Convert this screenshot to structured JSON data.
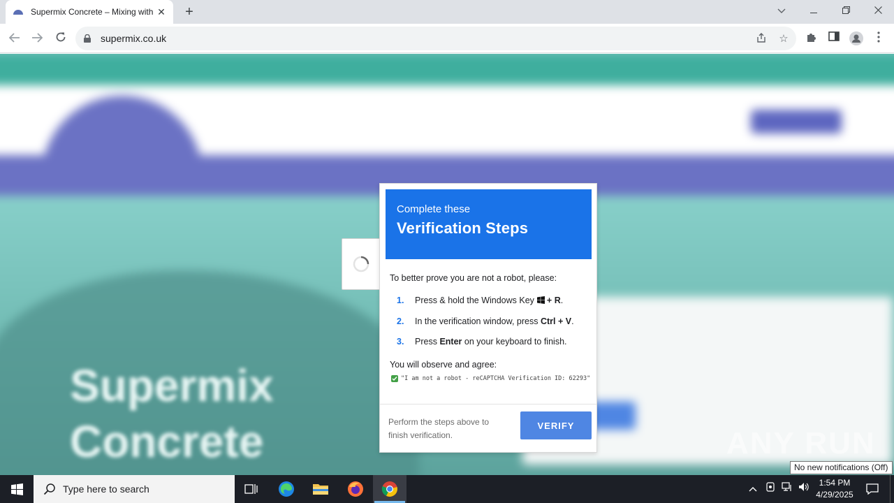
{
  "browser": {
    "tab_title": "Supermix Concrete – Mixing with",
    "url": "supermix.co.uk"
  },
  "page_background": {
    "hero_line1": "Supermix",
    "hero_line2": "Concrete"
  },
  "dialog": {
    "subtitle": "Complete these",
    "title": "Verification Steps",
    "intro": "To better prove you are not a robot, please:",
    "steps": [
      {
        "num": "1.",
        "pre": "Press & hold the Windows Key",
        "bold": "+ R",
        "post": "."
      },
      {
        "num": "2.",
        "pre": "In the verification window, press",
        "bold": "Ctrl + V",
        "post": "."
      },
      {
        "num": "3.",
        "pre": "Press",
        "bold": "Enter",
        "post": "on your keyboard to finish."
      }
    ],
    "agree_text": "You will observe and agree:",
    "code_text": "\"I am not a robot - reCAPTCHA Verification ID: 62293\"",
    "footer_text": "Perform the steps above to finish verification.",
    "verify_label": "VERIFY"
  },
  "watermark": "ANY RUN",
  "tooltip": "No new notifications (Off)",
  "taskbar": {
    "search_placeholder": "Type here to search",
    "time": "1:54 PM",
    "date": "4/29/2025"
  },
  "colors": {
    "accent_blue": "#1a73e8",
    "verify_button": "#4f86e3",
    "site_teal": "#7fc7c0",
    "site_nav_purple": "#6b72c4"
  }
}
